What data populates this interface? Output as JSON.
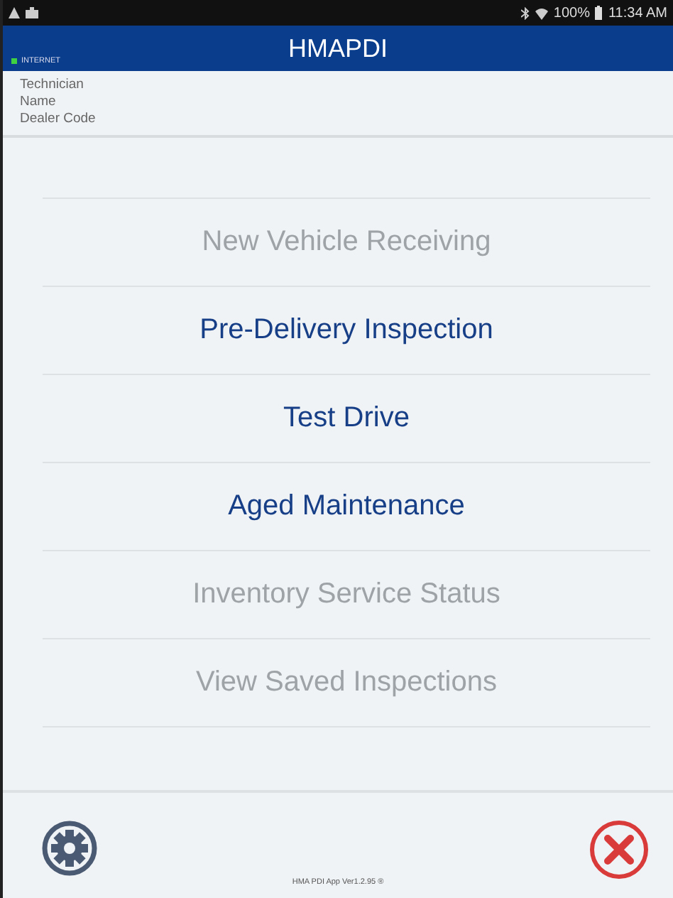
{
  "status_bar": {
    "battery": "100%",
    "time": "11:34 AM"
  },
  "header": {
    "title": "HMAPDI",
    "connection": {
      "label": "INTERNET",
      "color": "#3fd13f"
    }
  },
  "info": [
    "Technician",
    "Name",
    "Dealer Code"
  ],
  "menu": [
    {
      "label": "New Vehicle Receiving",
      "disabled": true
    },
    {
      "label": "Pre-Delivery Inspection",
      "disabled": false
    },
    {
      "label": "Test Drive",
      "disabled": false
    },
    {
      "label": "Aged Maintenance",
      "disabled": false
    },
    {
      "label": "Inventory Service Status",
      "disabled": true
    },
    {
      "label": "View Saved Inspections",
      "disabled": true
    }
  ],
  "footer": {
    "version": "HMA PDI App Ver1.2.95 ®"
  }
}
